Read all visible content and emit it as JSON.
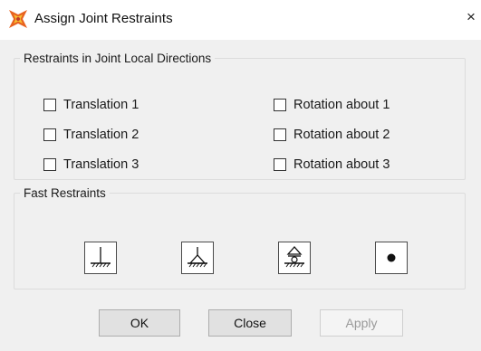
{
  "window": {
    "title": "Assign Joint Restraints",
    "close_glyph": "×",
    "icon": "restraint-app-icon"
  },
  "restraints_group": {
    "legend": "Restraints in Joint Local Directions",
    "items": [
      {
        "label": "Translation 1",
        "checked": false
      },
      {
        "label": "Translation 2",
        "checked": false
      },
      {
        "label": "Translation 3",
        "checked": false
      },
      {
        "label": "Rotation about 1",
        "checked": false
      },
      {
        "label": "Rotation about 2",
        "checked": false
      },
      {
        "label": "Rotation about 3",
        "checked": false
      }
    ]
  },
  "fast_restraints": {
    "legend": "Fast Restraints",
    "buttons": [
      {
        "icon": "fixed-support-icon"
      },
      {
        "icon": "pinned-support-icon"
      },
      {
        "icon": "roller-support-icon"
      },
      {
        "icon": "free-joint-icon"
      }
    ]
  },
  "buttons": {
    "ok": "OK",
    "close": "Close",
    "apply": "Apply",
    "apply_enabled": false
  }
}
